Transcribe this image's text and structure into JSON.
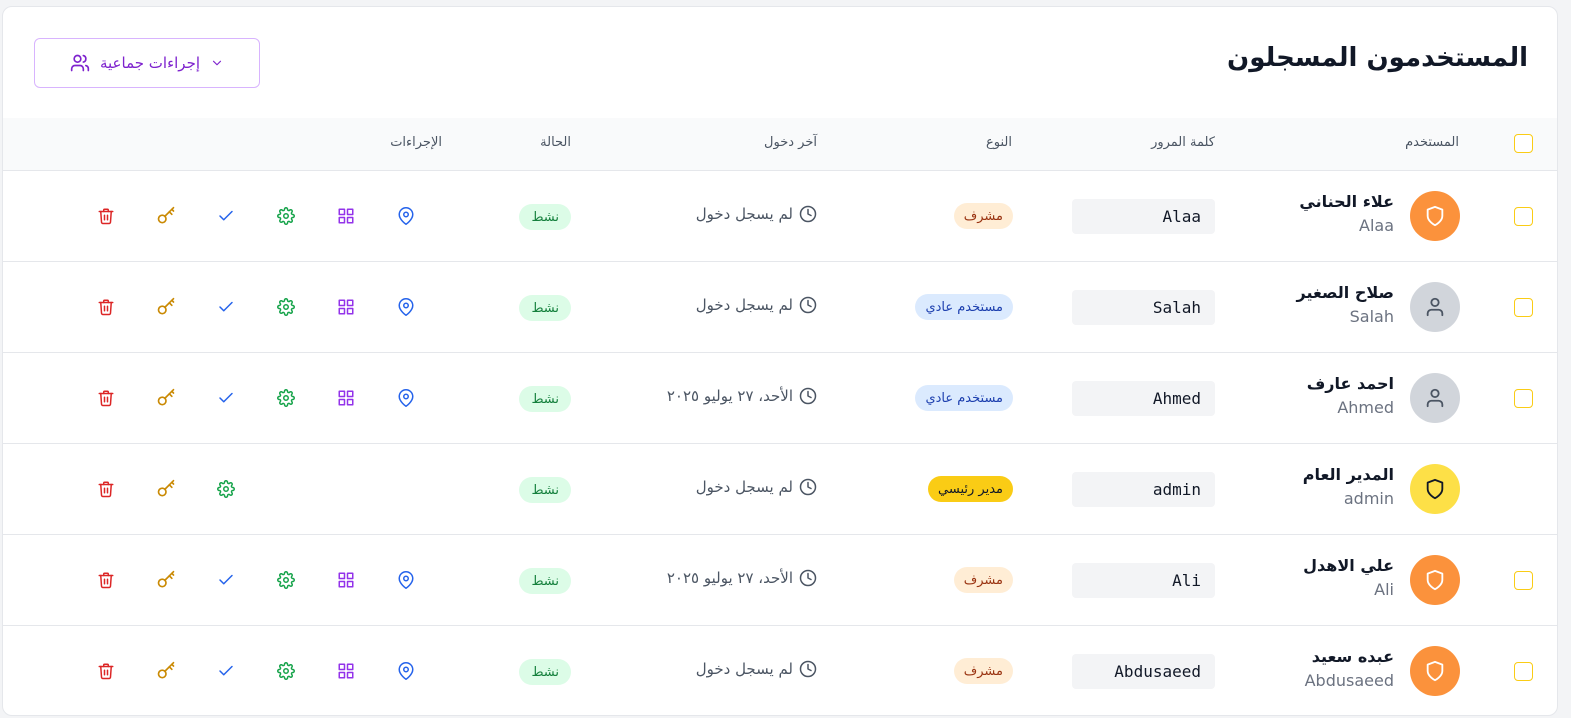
{
  "page": {
    "title": "المستخدمون المسجلون",
    "bulk_actions_label": "إجراءات جماعية"
  },
  "table": {
    "headers": {
      "user": "المستخدم",
      "password": "كلمة المرور",
      "type": "النوع",
      "last_login": "آخر دخول",
      "status": "الحالة",
      "actions": "الإجراءات"
    },
    "rows": [
      {
        "name": "علاء الحناني",
        "login": "Alaa",
        "password": "Alaa",
        "type": "مشرف",
        "type_kind": "supervisor",
        "last_login": "لم يسجل دخول",
        "status": "نشط",
        "avatar": "shield-icon",
        "avatar_color": "#fb923c",
        "selectable": true,
        "actions": [
          "location",
          "dashboard",
          "settings",
          "approve",
          "key",
          "delete"
        ]
      },
      {
        "name": "صلاح الصغير",
        "login": "Salah",
        "password": "Salah",
        "type": "مستخدم عادي",
        "type_kind": "user",
        "last_login": "لم يسجل دخول",
        "status": "نشط",
        "avatar": "user-icon",
        "avatar_color": "#d1d5db",
        "selectable": true,
        "actions": [
          "location",
          "dashboard",
          "settings",
          "approve",
          "key",
          "delete"
        ]
      },
      {
        "name": "احمد عارف",
        "login": "Ahmed",
        "password": "Ahmed",
        "type": "مستخدم عادي",
        "type_kind": "user",
        "last_login": "الأحد، ٢٧ يوليو ٢٠٢٥",
        "status": "نشط",
        "avatar": "user-icon",
        "avatar_color": "#d1d5db",
        "selectable": true,
        "actions": [
          "location",
          "dashboard",
          "settings",
          "approve",
          "key",
          "delete"
        ]
      },
      {
        "name": "المدير العام",
        "login": "admin",
        "password": "admin",
        "type": "مدير رئيسي",
        "type_kind": "admin",
        "last_login": "لم يسجل دخول",
        "status": "نشط",
        "avatar": "shield-icon",
        "avatar_color": "#fde047",
        "selectable": false,
        "actions": [
          "settings",
          "key",
          "delete"
        ]
      },
      {
        "name": "علي الاهدل",
        "login": "Ali",
        "password": "Ali",
        "type": "مشرف",
        "type_kind": "supervisor",
        "last_login": "الأحد، ٢٧ يوليو ٢٠٢٥",
        "status": "نشط",
        "avatar": "shield-icon",
        "avatar_color": "#fb923c",
        "selectable": true,
        "actions": [
          "location",
          "dashboard",
          "settings",
          "approve",
          "key",
          "delete"
        ]
      },
      {
        "name": "عبده سعيد",
        "login": "Abdusaeed",
        "password": "Abdusaeed",
        "type": "مشرف",
        "type_kind": "supervisor",
        "last_login": "لم يسجل دخول",
        "status": "نشط",
        "avatar": "shield-icon",
        "avatar_color": "#fb923c",
        "selectable": true,
        "actions": [
          "location",
          "dashboard",
          "settings",
          "approve",
          "key",
          "delete"
        ]
      }
    ]
  },
  "colors": {
    "accent_purple": "#7e22ce",
    "checkbox_border": "#facc15",
    "status_bg": "#dcfce7",
    "status_text": "#15803d",
    "supervisor_badge_bg": "#ffedd5",
    "supervisor_badge_text": "#9a3412",
    "user_badge_bg": "#dbeafe",
    "user_badge_text": "#1e40af",
    "admin_badge_bg": "#facc15",
    "admin_badge_text": "#111827",
    "icon_location": "#2563eb",
    "icon_dashboard": "#9333ea",
    "icon_settings": "#16a34a",
    "icon_approve": "#2563eb",
    "icon_key": "#ca8a04",
    "icon_delete": "#dc2626"
  }
}
